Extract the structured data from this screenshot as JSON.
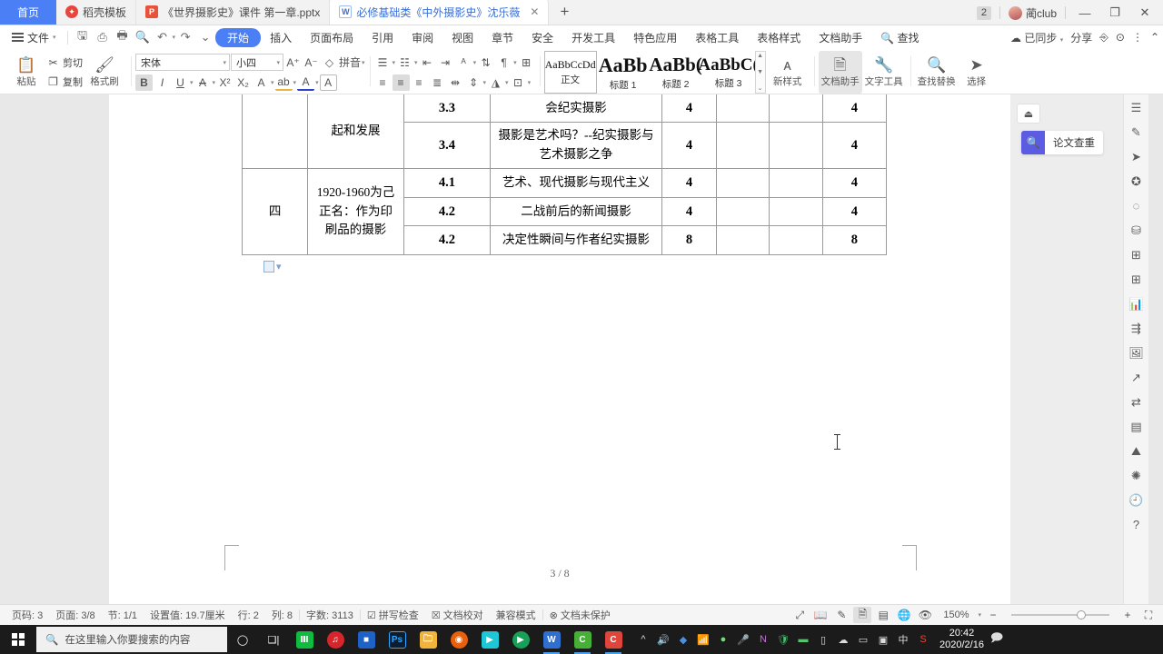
{
  "titlebar": {
    "home_tab": "首页",
    "tabs": [
      {
        "label": "稻壳模板",
        "icon": "wps-dove-icon",
        "active": false,
        "closable": false
      },
      {
        "label": "《世界摄影史》课件 第一章.pptx",
        "icon": "powerpoint-icon",
        "active": false,
        "closable": false
      },
      {
        "label": "必修基础类《中外摄影史》沈乐薇",
        "icon": "writer-doc-icon",
        "active": true,
        "closable": true
      }
    ],
    "new_tab": "+",
    "badge_count": "2",
    "user_name": "蔺club",
    "minimize": "—",
    "restore": "❐",
    "close": "✕"
  },
  "menubar": {
    "file": "文件",
    "quick_icons": [
      "save-icon",
      "print-icon",
      "print-preview-icon",
      "find-doc-icon",
      "undo-icon",
      "redo-icon",
      "customize-qat-icon"
    ],
    "tabs": [
      "开始",
      "插入",
      "页面布局",
      "引用",
      "审阅",
      "视图",
      "章节",
      "安全",
      "开发工具",
      "特色应用",
      "表格工具",
      "表格样式",
      "文档助手"
    ],
    "active_tab": "开始",
    "search": "查找",
    "sync_status": "已同步",
    "share": "分享",
    "collaborate_icon": "collaborate-icon",
    "help_icon": "help-icon",
    "more_icon": "more-icon",
    "collapse_icon": "collapse-ribbon-icon"
  },
  "ribbon": {
    "clipboard": {
      "paste": "粘贴",
      "cut": "剪切",
      "copy": "复制",
      "format_painter": "格式刷"
    },
    "font": {
      "family": "宋体",
      "size": "小四",
      "grow": "A⁺",
      "shrink": "A⁻",
      "clear_format": "clear-format-icon",
      "pinyin": "拼音",
      "bold": "B",
      "italic": "I",
      "underline": "U",
      "strikethrough": "A",
      "superscript": "X²",
      "subscript": "X₂",
      "char_border": "A",
      "highlight": "ab",
      "font_color": "A",
      "char_shading": "A"
    },
    "paragraph": {
      "bullets": "bullet-list-icon",
      "numbering": "numbered-list-icon",
      "decrease_indent": "decrease-indent-icon",
      "increase_indent": "increase-indent-icon",
      "pinyin_guide": "pinyin-guide-icon",
      "sort": "sort-icon",
      "show_marks": "show-marks-icon",
      "borders": "borders-icon",
      "align_left": "align-left-icon",
      "align_center": "align-center-icon",
      "align_right": "align-right-icon",
      "justify": "justify-icon",
      "distribute": "distribute-icon",
      "line_spacing": "line-spacing-icon",
      "shading": "shading-icon",
      "table_borders": "table-borders-icon"
    },
    "styles": [
      {
        "preview": "AaBbCcDd",
        "name": "正文",
        "selected": true
      },
      {
        "preview": "AaBb",
        "name": "标题 1",
        "selected": false
      },
      {
        "preview": "AaBb(",
        "name": "标题 2",
        "selected": false
      },
      {
        "preview": "AaBbC(",
        "name": "标题 3",
        "selected": false
      }
    ],
    "new_style": "新样式",
    "doc_assistant": "文档助手",
    "text_tools": "文字工具",
    "find_replace": "查找替换",
    "select": "选择"
  },
  "document": {
    "table": {
      "rows": [
        {
          "idx": "",
          "era": "起和发展",
          "no": "3.3",
          "topic": "会纪实摄影",
          "h1": "4",
          "h2": "",
          "h3": "",
          "h4": "4",
          "clipped": true
        },
        {
          "idx": "",
          "era": "",
          "no": "3.4",
          "topic": "摄影是艺术吗？--纪实摄影与艺术摄影之争",
          "h1": "4",
          "h2": "",
          "h3": "",
          "h4": "4",
          "clipped": false
        },
        {
          "idx": "四",
          "era": "1920-1960为己正名：作为印刷品的摄影",
          "no": "4.1",
          "topic": "艺术、现代摄影与现代主义",
          "h1": "4",
          "h2": "",
          "h3": "",
          "h4": "4",
          "clipped": false
        },
        {
          "idx": "",
          "era": "",
          "no": "4.2",
          "topic": "二战前后的新闻摄影",
          "h1": "4",
          "h2": "",
          "h3": "",
          "h4": "4",
          "clipped": false
        },
        {
          "idx": "",
          "era": "",
          "no": "4.2",
          "topic": "决定性瞬间与作者纪实摄影",
          "h1": "8",
          "h2": "",
          "h3": "",
          "h4": "8",
          "clipped": false
        }
      ]
    },
    "page_indicator": "3 / 8"
  },
  "sidepanel": {
    "eject_icon": "eject-icon",
    "paper_check_label": "论文查重",
    "paper_check_icon": "doc-search-icon",
    "rail_icons": [
      "menu-icon",
      "pen-icon",
      "cursor-icon",
      "badge-icon",
      "shape-icon",
      "stack-icon",
      "table-icon",
      "apps-icon",
      "chart-icon",
      "flow-icon",
      "image-gallery-icon",
      "export-icon",
      "ocr-icon",
      "archive-icon",
      "picture-icon",
      "compass-icon",
      "history-icon",
      "help-circle-icon"
    ]
  },
  "statusbar": {
    "items": [
      "页码: 3",
      "页面: 3/8",
      "节: 1/1",
      "设置值: 19.7厘米",
      "行: 2",
      "列: 8",
      "字数: 3113"
    ],
    "spell_check": "拼写检查",
    "doc_proof": "文档校对",
    "compat_mode": "兼容模式",
    "protection": "文档未保护",
    "view_icons": [
      "fullscreen-icon",
      "reading-layout-icon",
      "edit-icon",
      "page-layout-icon",
      "outline-icon",
      "web-layout-icon",
      "eye-protect-icon"
    ],
    "zoom_level": "150%",
    "zoom_out": "−",
    "zoom_in": "+",
    "fit_page": "fit-page-icon"
  },
  "taskbar": {
    "start_icon": "windows-start-icon",
    "search_placeholder": "在这里输入你要搜索的内容",
    "cortana_icon": "cortana-icon",
    "taskview_icon": "task-view-icon",
    "apps": [
      {
        "name": "app-green-icon",
        "glyph": "Ⅲ",
        "bg": "#0fbc3f",
        "running": false
      },
      {
        "name": "netease-music-icon",
        "glyph": "♫",
        "bg": "#d7262b",
        "running": false
      },
      {
        "name": "app-blue-icon",
        "glyph": "■",
        "bg": "#1f62c7",
        "running": false
      },
      {
        "name": "photoshop-icon",
        "glyph": "Ps",
        "bg": "#0b1d2e",
        "running": false
      },
      {
        "name": "file-explorer-icon",
        "glyph": "🗀",
        "bg": "#f2b33d",
        "running": false
      },
      {
        "name": "firefox-icon",
        "glyph": "◉",
        "bg": "#e8600c",
        "running": false
      },
      {
        "name": "youku-icon",
        "glyph": "▶",
        "bg": "#1ec6d6",
        "running": false
      },
      {
        "name": "media-player-icon",
        "glyph": "▶",
        "bg": "#18a058",
        "running": false
      },
      {
        "name": "wps-writer-icon",
        "glyph": "W",
        "bg": "#2f6fd0",
        "running": true
      },
      {
        "name": "app-green2-icon",
        "glyph": "C",
        "bg": "#45b035",
        "running": true
      },
      {
        "name": "app-red-icon",
        "glyph": "C",
        "bg": "#e0453c",
        "running": true
      }
    ],
    "tray_icons": [
      "chevron-up-icon",
      "volume-icon",
      "seewo-icon",
      "wifi-icon",
      "wechat-icon",
      "mic-icon",
      "onenote-icon",
      "shield-icon",
      "cash-icon",
      "battery-icon",
      "cloud-icon",
      "screen-icon",
      "capture-icon",
      "input-icon",
      "sogou-icon"
    ],
    "time": "20:42",
    "date": "2020/2/16",
    "notification_icon": "notification-icon"
  },
  "colors": {
    "accent": "#4b7ff5",
    "taskbar_bg": "#1b1b1b",
    "workspace_bg": "#e8e8e8",
    "paper_check_bg": "#5b5ce2"
  }
}
